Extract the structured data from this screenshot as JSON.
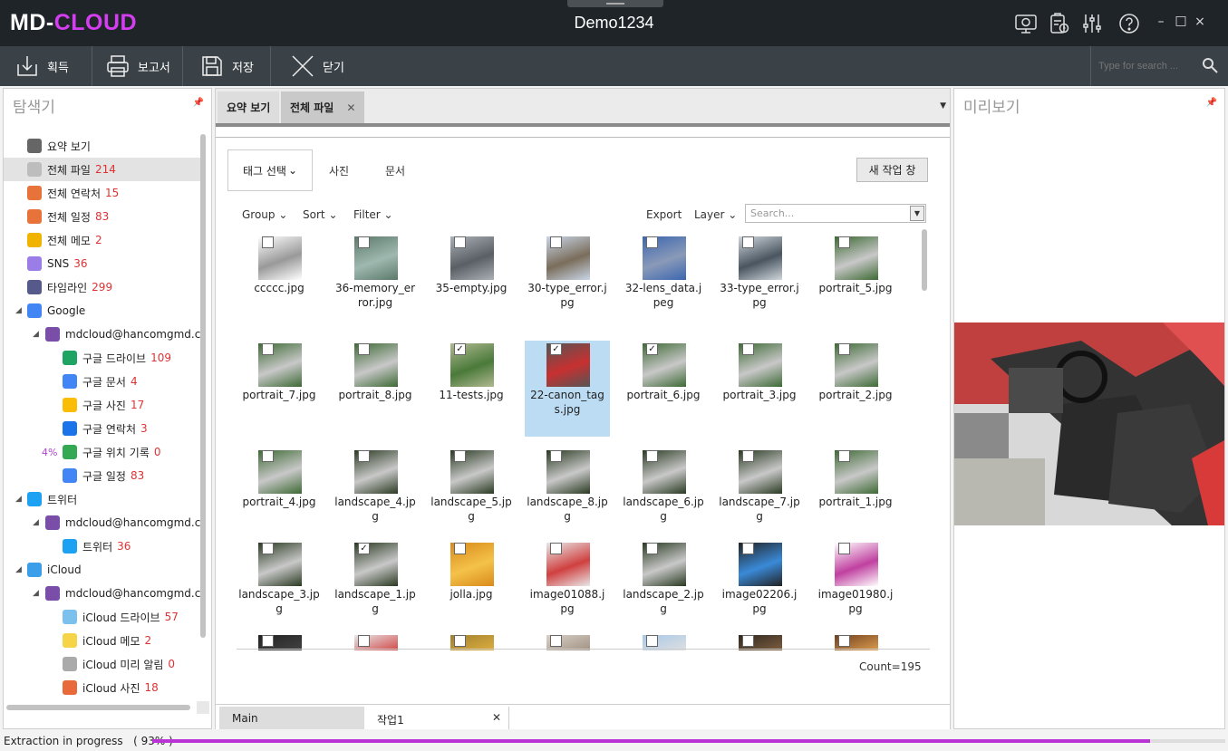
{
  "app": {
    "logo_part1": "MD-",
    "logo_part2": "CLOUD",
    "window_title": "Demo1234"
  },
  "toolbar": {
    "acquire": "획득",
    "report": "보고서",
    "save": "저장",
    "close": "닫기",
    "search_placeholder": "Type for search ..."
  },
  "explorer": {
    "title": "탐색기",
    "items": [
      {
        "label": "요약 보기",
        "count": "",
        "icon": "pulse-icon",
        "color": "#666666"
      },
      {
        "label": "전체 파일",
        "count": "214",
        "icon": "file-icon",
        "color": "#bdbdbd"
      },
      {
        "label": "전체 연락처",
        "count": "15",
        "icon": "phone-icon",
        "color": "#e8733a"
      },
      {
        "label": "전체 일정",
        "count": "83",
        "icon": "calendar-icon",
        "color": "#e8733a"
      },
      {
        "label": "전체  메모",
        "count": "2",
        "icon": "memo-icon",
        "color": "#f0b400"
      },
      {
        "label": "SNS",
        "count": "36",
        "icon": "cloud-icon",
        "color": "#9b7de8"
      },
      {
        "label": "타임라인",
        "count": "299",
        "icon": "timeline-icon",
        "color": "#555a8a"
      },
      {
        "label": "Google",
        "count": "",
        "icon": "google-icon",
        "color": "#4285f4"
      },
      {
        "label": "mdcloud@hancomgmd.com",
        "count": "",
        "icon": "account-icon",
        "color": "#7a4ea8"
      },
      {
        "label": "구글 드라이브",
        "count": "109",
        "icon": "google-drive-icon",
        "color": "#1fa463"
      },
      {
        "label": "구글 문서",
        "count": "4",
        "icon": "google-docs-icon",
        "color": "#4285f4"
      },
      {
        "label": "구글 사진",
        "count": "17",
        "icon": "google-photos-icon",
        "color": "#fbbc05"
      },
      {
        "label": "구글 연락처",
        "count": "3",
        "icon": "google-contacts-icon",
        "color": "#1a73e8"
      },
      {
        "label": "구글 위치 기록",
        "count": "0",
        "icon": "google-maps-icon",
        "color": "#34a853",
        "pct": "4%"
      },
      {
        "label": "구글 일정",
        "count": "83",
        "icon": "google-calendar-icon",
        "color": "#4285f4"
      },
      {
        "label": "트위터",
        "count": "",
        "icon": "twitter-icon",
        "color": "#1da1f2"
      },
      {
        "label": "mdcloud@hancomgmd.com",
        "count": "",
        "icon": "account-icon",
        "color": "#7a4ea8"
      },
      {
        "label": "트위터",
        "count": "36",
        "icon": "twitter-icon",
        "color": "#1da1f2"
      },
      {
        "label": "iCloud",
        "count": "",
        "icon": "icloud-icon",
        "color": "#3a9ee8"
      },
      {
        "label": "mdcloud@hancomgmd.com",
        "count": "",
        "icon": "account-icon",
        "color": "#7a4ea8"
      },
      {
        "label": "iCloud 드라이브",
        "count": "57",
        "icon": "icloud-drive-icon",
        "color": "#7cc1ee"
      },
      {
        "label": "iCloud 메모",
        "count": "2",
        "icon": "icloud-notes-icon",
        "color": "#f5d547"
      },
      {
        "label": "iCloud 미리 알림",
        "count": "0",
        "icon": "reminders-icon",
        "color": "#aaaaaa"
      },
      {
        "label": "iCloud 사진",
        "count": "18",
        "icon": "icloud-photos-icon",
        "color": "#e86a3a"
      }
    ]
  },
  "tabs": {
    "summary": "요약 보기",
    "all_files": "전체 파일"
  },
  "filters": {
    "tag_select": "태그 선택",
    "photos": "사진",
    "docs": "문서",
    "new_window": "새 작업 창",
    "group": "Group",
    "sort": "Sort",
    "filter": "Filter",
    "export": "Export",
    "layer": "Layer",
    "search_placeholder": "Search..."
  },
  "files": [
    {
      "name": "ccccc.jpg",
      "checked": false,
      "c": [
        "#ffffff",
        "#999999"
      ]
    },
    {
      "name": "36-memory_error.jpg",
      "checked": false,
      "c": [
        "#5b7a6a",
        "#9fb8b0"
      ]
    },
    {
      "name": "35-empty.jpg",
      "checked": false,
      "c": [
        "#aab0b5",
        "#5a5f66"
      ]
    },
    {
      "name": "30-type_error.jpg",
      "checked": false,
      "c": [
        "#c9d6e8",
        "#7a6d5a"
      ]
    },
    {
      "name": "32-lens_data.jpeg",
      "checked": false,
      "c": [
        "#3c66b0",
        "#8a9ab8"
      ]
    },
    {
      "name": "33-type_error.jpg",
      "checked": false,
      "c": [
        "#cfd6dc",
        "#4a5560"
      ]
    },
    {
      "name": "portrait_5.jpg",
      "checked": false,
      "c": [
        "#3d6a34",
        "#c8c8c8"
      ]
    },
    {
      "name": "portrait_7.jpg",
      "checked": false,
      "c": [
        "#3d6a34",
        "#c8c8c8"
      ]
    },
    {
      "name": "portrait_8.jpg",
      "checked": false,
      "c": [
        "#3d6a34",
        "#c8c8c8"
      ]
    },
    {
      "name": "11-tests.jpg",
      "checked": true,
      "c": [
        "#b0b890",
        "#4a7a3a"
      ]
    },
    {
      "name": "22-canon_tags.jpg",
      "checked": true,
      "c": [
        "#555555",
        "#c83030"
      ]
    },
    {
      "name": "portrait_6.jpg",
      "checked": true,
      "c": [
        "#3d6a34",
        "#c8c8c8"
      ]
    },
    {
      "name": "portrait_3.jpg",
      "checked": false,
      "c": [
        "#3d6a34",
        "#c8c8c8"
      ]
    },
    {
      "name": "portrait_2.jpg",
      "checked": false,
      "c": [
        "#3d6a34",
        "#c8c8c8"
      ]
    },
    {
      "name": "portrait_4.jpg",
      "checked": false,
      "c": [
        "#3d6a34",
        "#c8c8c8"
      ]
    },
    {
      "name": "landscape_4.jpg",
      "checked": false,
      "c": [
        "#2a3a22",
        "#c8c8c8"
      ]
    },
    {
      "name": "landscape_5.jpg",
      "checked": false,
      "c": [
        "#2a3a22",
        "#c8c8c8"
      ]
    },
    {
      "name": "landscape_8.jpg",
      "checked": false,
      "c": [
        "#2a3a22",
        "#c8c8c8"
      ]
    },
    {
      "name": "landscape_6.jpg",
      "checked": false,
      "c": [
        "#2a3a22",
        "#c8c8c8"
      ]
    },
    {
      "name": "landscape_7.jpg",
      "checked": false,
      "c": [
        "#2a3a22",
        "#c8c8c8"
      ]
    },
    {
      "name": "portrait_1.jpg",
      "checked": false,
      "c": [
        "#3d6a34",
        "#c8c8c8"
      ]
    },
    {
      "name": "landscape_3.jpg",
      "checked": false,
      "c": [
        "#2a3a22",
        "#c8c8c8"
      ]
    },
    {
      "name": "landscape_1.jpg",
      "checked": true,
      "c": [
        "#2a3a22",
        "#c8c8c8"
      ]
    },
    {
      "name": "jolla.jpg",
      "checked": false,
      "c": [
        "#d98a1a",
        "#f4c24a"
      ]
    },
    {
      "name": "image01088.jpg",
      "checked": false,
      "c": [
        "#e8e8e8",
        "#d04040"
      ]
    },
    {
      "name": "landscape_2.jpg",
      "checked": false,
      "c": [
        "#2a3a22",
        "#c8c8c8"
      ]
    },
    {
      "name": "image02206.jpg",
      "checked": false,
      "c": [
        "#222222",
        "#3a8ad8"
      ]
    },
    {
      "name": "image01980.jpg",
      "checked": false,
      "c": [
        "#ffffff",
        "#c040a0"
      ]
    },
    {
      "name": "",
      "checked": false,
      "c": [
        "#222222",
        "#444444"
      ]
    },
    {
      "name": "",
      "checked": false,
      "c": [
        "#e8e8e8",
        "#d04040"
      ]
    },
    {
      "name": "",
      "checked": false,
      "c": [
        "#a08030",
        "#e0b040"
      ]
    },
    {
      "name": "",
      "checked": false,
      "c": [
        "#d8d0c8",
        "#a09080"
      ]
    },
    {
      "name": "",
      "checked": false,
      "c": [
        "#a8c8e8",
        "#e0e0e0"
      ]
    },
    {
      "name": "",
      "checked": false,
      "c": [
        "#302820",
        "#806040"
      ]
    },
    {
      "name": "",
      "checked": false,
      "c": [
        "#704020",
        "#e0a050"
      ]
    }
  ],
  "selected_index": 10,
  "count_label": "Count=195",
  "bottom_tabs": {
    "main": "Main",
    "work1": "작업1"
  },
  "preview": {
    "title": "미리보기"
  },
  "status": {
    "text": "Extraction in progress",
    "percent_label": "( 93% )",
    "progress": 0.93
  },
  "colors": {
    "accent": "#d43df0",
    "count_red": "#dd3333",
    "selected_bg": "#bcdcf3"
  }
}
